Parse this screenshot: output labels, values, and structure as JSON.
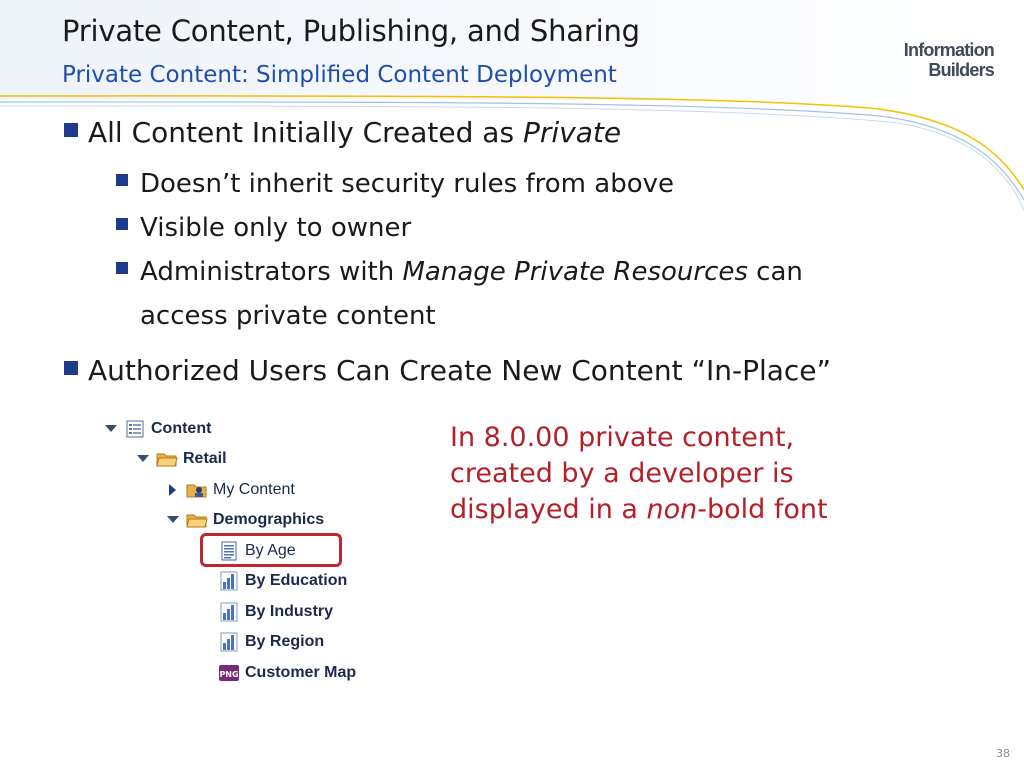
{
  "slide": {
    "title": "Private Content, Publishing, and Sharing",
    "subtitle": "Private Content: Simplified Content Deployment",
    "logo": {
      "line1": "Information",
      "line2": "Builders"
    },
    "bullets": {
      "b1": {
        "text": "All Content Initially Created as ",
        "italic": "Private"
      },
      "b1_subs": [
        {
          "text": "Doesn’t inherit security rules from above"
        },
        {
          "text": "Visible only to owner"
        },
        {
          "pre": "Administrators with ",
          "italic": "Manage Private Resources",
          "post": " can",
          "line2": "access private content"
        }
      ],
      "b2": {
        "text": "Authorized Users Can Create New Content “In-Place”"
      }
    },
    "tree": [
      {
        "label": "Content",
        "bold": true,
        "icon": "content-list-icon",
        "expanded": true
      },
      {
        "label": "Retail",
        "bold": true,
        "icon": "folder-open-icon",
        "expanded": true
      },
      {
        "label": "My Content",
        "bold": false,
        "icon": "user-folder-icon",
        "expanded": false
      },
      {
        "label": "Demographics",
        "bold": true,
        "icon": "folder-open-icon",
        "expanded": true
      },
      {
        "label": "By Age",
        "bold": false,
        "icon": "report-document-icon"
      },
      {
        "label": "By Education",
        "bold": true,
        "icon": "bar-chart-icon"
      },
      {
        "label": "By Industry",
        "bold": true,
        "icon": "bar-chart-icon"
      },
      {
        "label": "By Region",
        "bold": true,
        "icon": "bar-chart-icon"
      },
      {
        "label": "Customer Map",
        "bold": true,
        "icon": "png-file-icon"
      }
    ],
    "callout": {
      "line1": "In 8.0.00 private content,",
      "line2": "created by a developer is",
      "line3_pre": "displayed in a ",
      "line3_italic": "non",
      "line3_post": "-bold font"
    },
    "page_number": "38",
    "colors": {
      "accent": "#1f4fa8",
      "bullet": "#1f3b8c",
      "callout": "#b3202a",
      "swoosh": "#f2c200"
    }
  }
}
